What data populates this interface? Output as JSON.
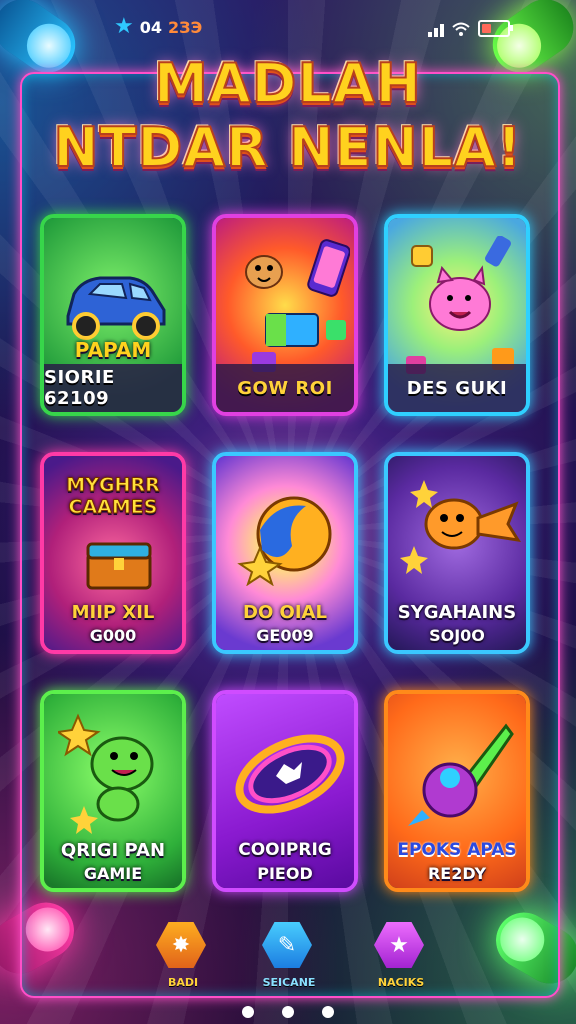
{
  "status_bar": {
    "icon": "star-icon",
    "time": "04",
    "value": "2ЗЭ"
  },
  "title": {
    "line1": "MADLAH",
    "line2": "NTDAR NENLA!"
  },
  "cards": [
    {
      "label": "SIORIE 62109",
      "art_text": "PAPAM",
      "icon": "car-icon",
      "color": "#37d64a"
    },
    {
      "label": "GOW ROI",
      "icon": "monster-icon",
      "color": "#e040e0"
    },
    {
      "label": "DES GUKI",
      "icon": "pig-icon",
      "color": "#2fd0ff"
    },
    {
      "art_text": "MYGHRR CAAMES",
      "label_line1": "MIIP XIL",
      "label_line2": "G000",
      "icon": "treasure-chest-icon",
      "color": "#ff3aa6"
    },
    {
      "label_line1": "DO OIAL",
      "label_line2": "GE009",
      "icon": "planet-icon",
      "color": "#3ac8ff"
    },
    {
      "label_line1": "SYGAHAINS",
      "label_line2": "SOJ0O",
      "icon": "fish-icon",
      "color": "#3ac8ff"
    },
    {
      "label_line1": "QRIGI PAN",
      "label_line2": "GAMIE",
      "icon": "dragon-icon",
      "color": "#5cf04c"
    },
    {
      "label_line1": "COOIPRIG",
      "label_line2": "PIEOD",
      "icon": "portal-icon",
      "color": "#d04cff"
    },
    {
      "label_line1": "EPOKS APAS",
      "label_line2": "RE2DY",
      "icon": "rocket-icon",
      "color": "#ff8a1a"
    }
  ],
  "nav": [
    {
      "label": "BADI",
      "icon": "star-burst-icon",
      "color": "#ff8a1a"
    },
    {
      "label": "SEICANE",
      "icon": "pencil-icon",
      "color": "#1ab6ff"
    },
    {
      "label": "NACIKS",
      "icon": "star-icon",
      "color": "#e050ff"
    }
  ],
  "pager": {
    "count": 3
  }
}
